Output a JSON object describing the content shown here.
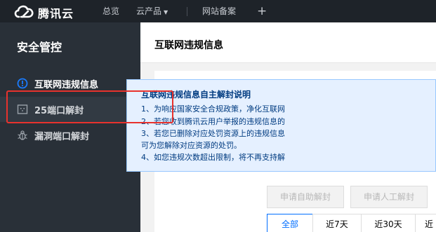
{
  "topbar": {
    "logo_text": "腾讯云",
    "nav": {
      "overview": "总览",
      "products": "云产品",
      "record": "网站备案",
      "plus": "+"
    },
    "logo_icon": "cloud-logo-icon"
  },
  "sidebar": {
    "title": "安全管控",
    "items": [
      {
        "label": "互联网违规信息",
        "icon": "alert-circle-icon",
        "active": true
      },
      {
        "label": "25端口解封",
        "icon": "port-icon"
      },
      {
        "label": "漏洞端口解封",
        "icon": "bug-icon"
      }
    ]
  },
  "main": {
    "title": "互联网违规信息",
    "notice": {
      "title": "互联网违规信息自主解封说明",
      "lines": [
        "1、为响应国家安全合规政策，净化互联网",
        "2、若您收到腾讯云用户举报的违规信息的",
        "3、若您已删除对应处罚资源上的违规信息",
        "可为您解除对应资源的处罚。",
        "4、如您违规次数超出限制，将不再支持解"
      ]
    },
    "buttons": {
      "self_unblock": "申请自助解封",
      "manual_unblock": "申请人工解封"
    },
    "tabs": [
      "全部",
      "近7天",
      "近30天",
      "近"
    ]
  },
  "colors": {
    "topbar_bg": "#1e2329",
    "sidebar_bg": "#293038",
    "accent": "#006eff",
    "highlight": "#e8322d",
    "notice_bg": "#e5f0ff"
  }
}
